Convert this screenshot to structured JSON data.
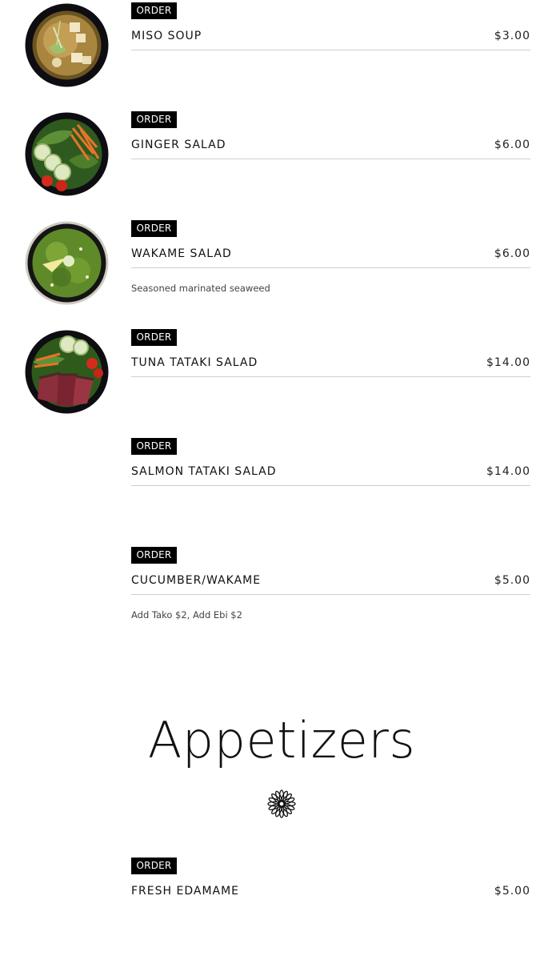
{
  "order_label": "ORDER",
  "items": [
    {
      "name": "MISO SOUP",
      "price": "$3.00",
      "description": "",
      "image": "miso-soup-photo"
    },
    {
      "name": "GINGER SALAD",
      "price": "$6.00",
      "description": "",
      "image": "ginger-salad-photo"
    },
    {
      "name": "WAKAME SALAD",
      "price": "$6.00",
      "description": "Seasoned marinated seaweed",
      "image": "wakame-salad-photo"
    },
    {
      "name": "TUNA TATAKI SALAD",
      "price": "$14.00",
      "description": "",
      "image": "tuna-tataki-salad-photo"
    },
    {
      "name": "SALMON TATAKI SALAD",
      "price": "$14.00",
      "description": ""
    },
    {
      "name": "CUCUMBER/WAKAME",
      "price": "$5.00",
      "description": "Add Tako $2, Add Ebi $2"
    }
  ],
  "section": {
    "title": "Appetizers",
    "ornament_icon": "flower-ornament-icon"
  },
  "appetizers": [
    {
      "name": "FRESH EDAMAME",
      "price": "$5.00"
    }
  ],
  "colors": {
    "button_bg": "#000000",
    "button_text": "#ffffff",
    "rule": "#cfcfcf"
  }
}
